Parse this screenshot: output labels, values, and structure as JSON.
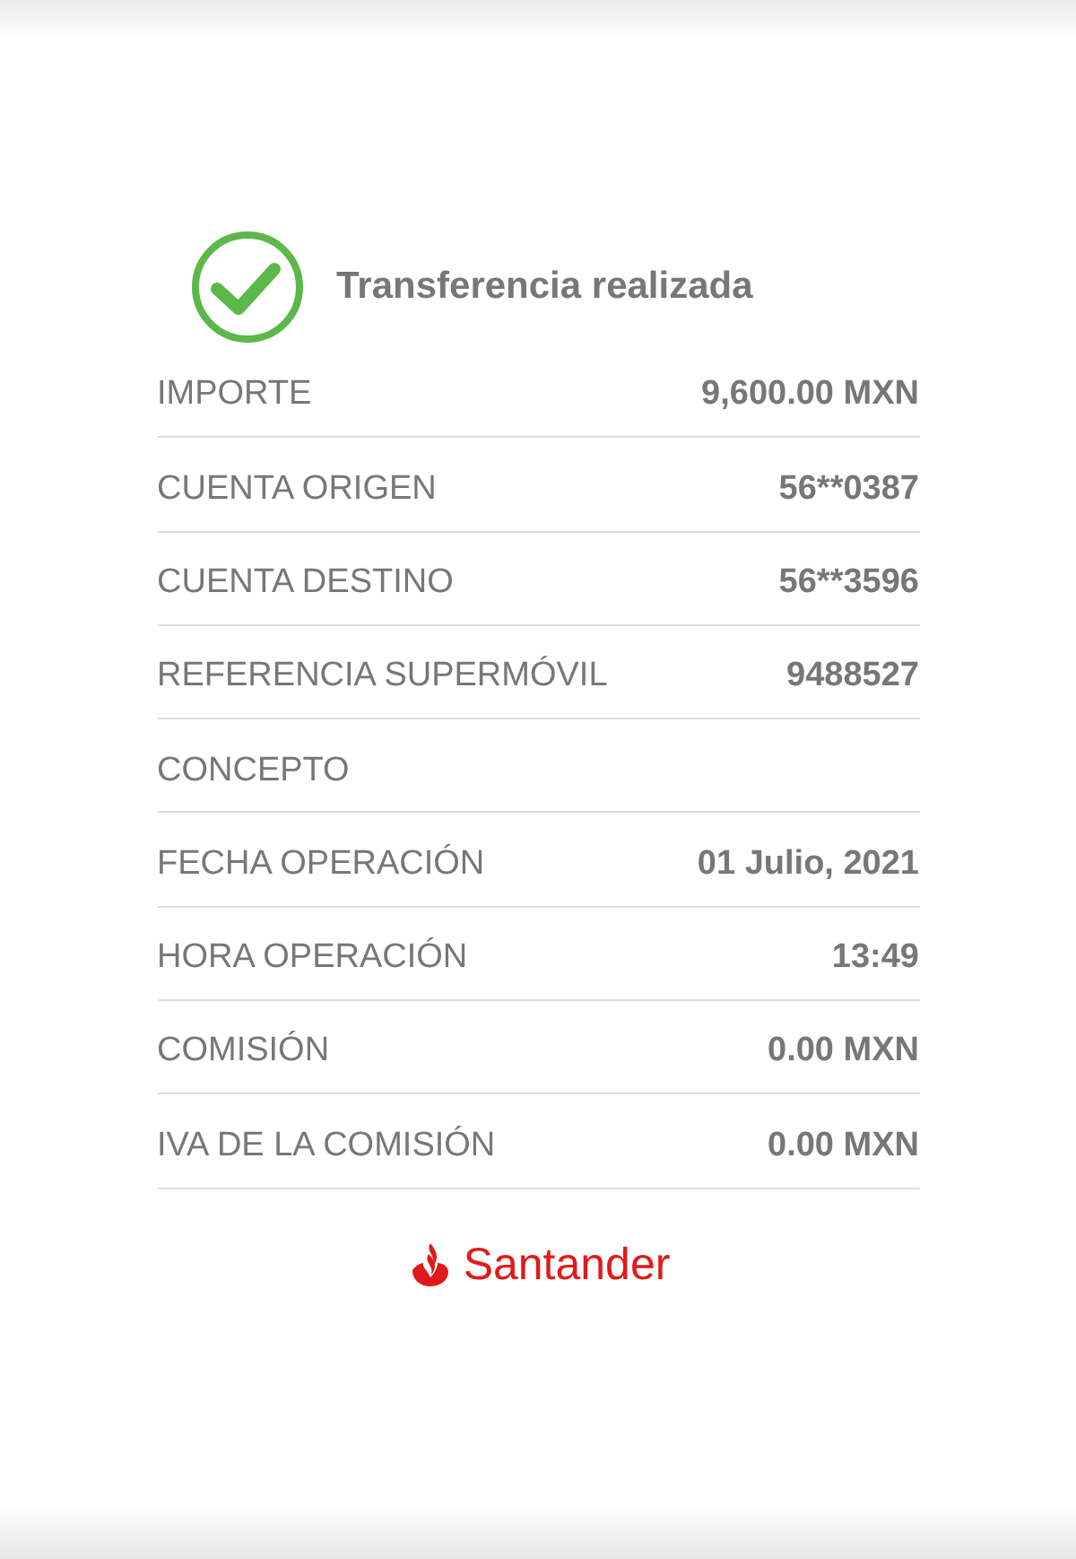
{
  "title": "Transferencia realizada",
  "rows": [
    {
      "label": "IMPORTE",
      "value": "9,600.00 MXN"
    },
    {
      "label": "CUENTA ORIGEN",
      "value": "56**0387"
    },
    {
      "label": "CUENTA DESTINO",
      "value": "56**3596"
    },
    {
      "label": "REFERENCIA SUPERMÓVIL",
      "value": "9488527"
    },
    {
      "label": "CONCEPTO"
    },
    {
      "label": "FECHA OPERACIÓN",
      "value": "01 Julio, 2021"
    },
    {
      "label": "HORA OPERACIÓN",
      "value": "13:49"
    },
    {
      "label": "COMISIÓN",
      "value": "0.00 MXN"
    },
    {
      "label": "IVA DE LA COMISIÓN",
      "value": "0.00 MXN"
    }
  ],
  "brand": "Santander"
}
